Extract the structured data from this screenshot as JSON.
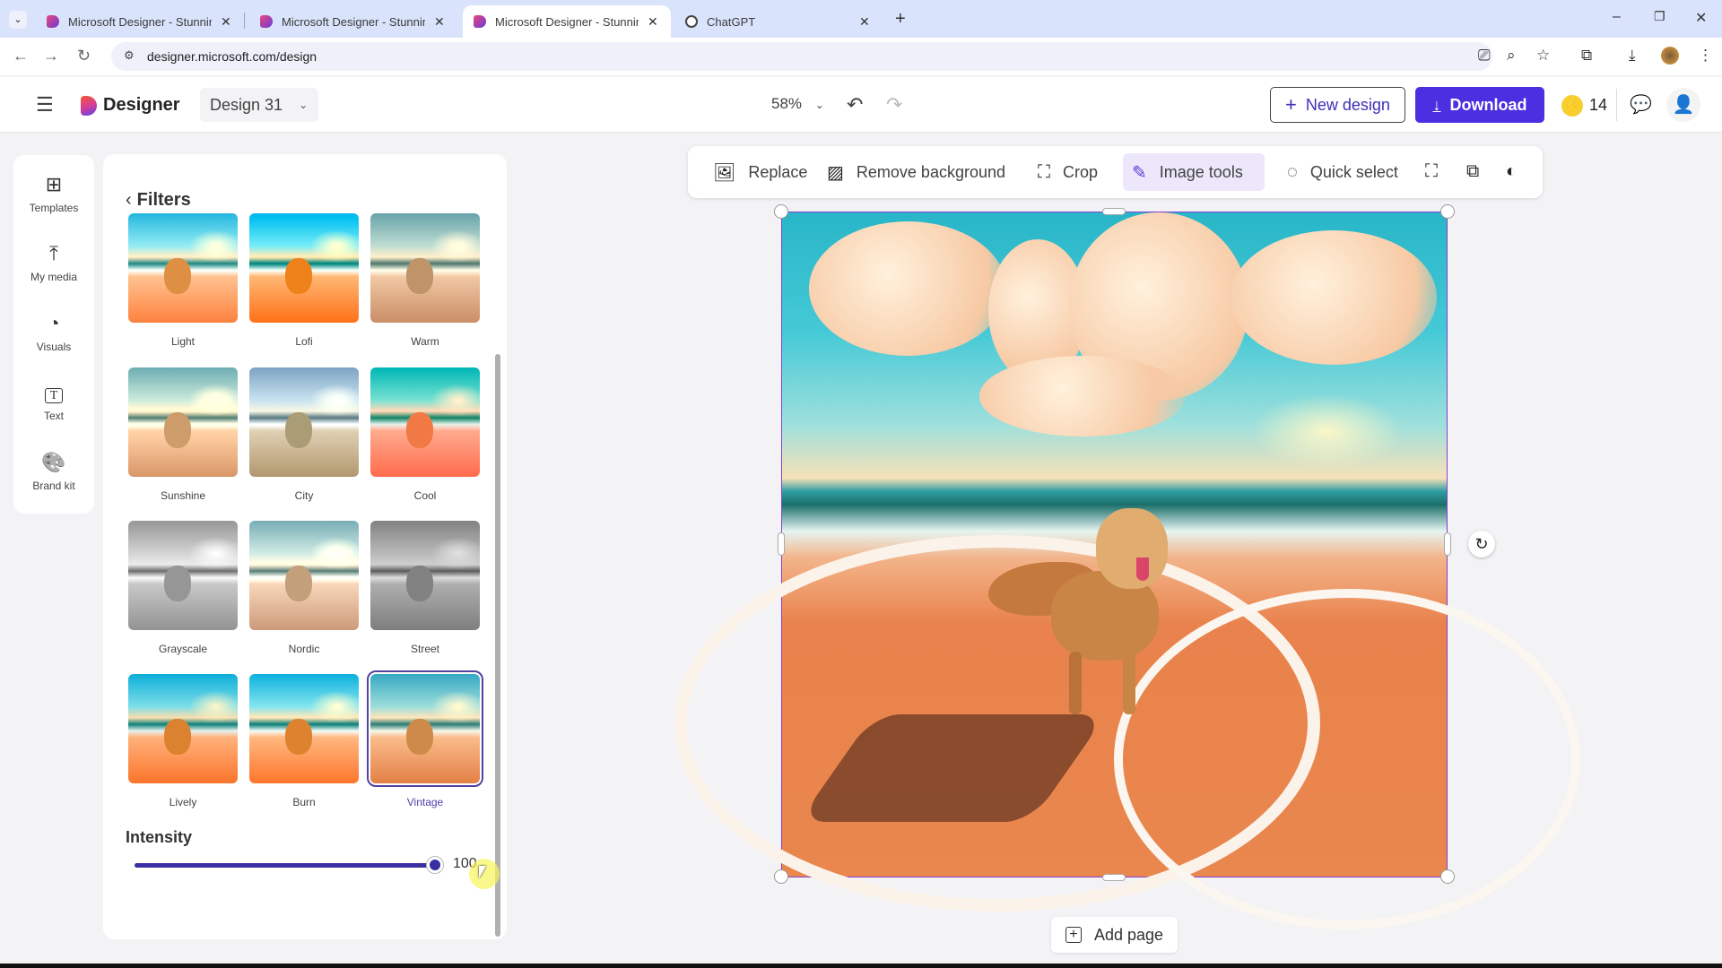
{
  "browser": {
    "tabs": [
      {
        "title": "Microsoft Designer - Stunning designs",
        "active": false,
        "icon": "designer-favicon"
      },
      {
        "title": "Microsoft Designer - Stunning designs",
        "active": false,
        "icon": "designer-favicon"
      },
      {
        "title": "Microsoft Designer - Stunning designs",
        "active": true,
        "icon": "designer-favicon"
      },
      {
        "title": "ChatGPT",
        "active": false,
        "icon": "chatgpt-favicon"
      }
    ],
    "new_tab": "+",
    "url": "designer.microsoft.com/design",
    "window_controls": {
      "minimize": "–",
      "restore": "❐",
      "close": "✕"
    }
  },
  "header": {
    "menu_icon": "☰",
    "app_name": "Designer",
    "design_name": "Design 31",
    "design_chevron": "⌄",
    "zoom": "58%",
    "zoom_chevron": "⌄",
    "undo": "↶",
    "redo": "↷",
    "new_design_label": "New design",
    "download_label": "Download",
    "credits": "14",
    "brand_color": "#4b2fe0"
  },
  "rail": {
    "items": [
      {
        "label": "Templates",
        "icon": "⊞"
      },
      {
        "label": "My media",
        "icon": "⤒"
      },
      {
        "label": "Visuals",
        "icon": "◔"
      },
      {
        "label": "Text",
        "icon": "T"
      },
      {
        "label": "Brand kit",
        "icon": "🎨"
      }
    ]
  },
  "filters": {
    "title": "Filters",
    "back": "‹",
    "items": [
      {
        "label": "Light",
        "selected": false
      },
      {
        "label": "Lofi",
        "selected": false
      },
      {
        "label": "Warm",
        "selected": false
      },
      {
        "label": "Sunshine",
        "selected": false
      },
      {
        "label": "City",
        "selected": false
      },
      {
        "label": "Cool",
        "selected": false
      },
      {
        "label": "Grayscale",
        "selected": false
      },
      {
        "label": "Nordic",
        "selected": false
      },
      {
        "label": "Street",
        "selected": false
      },
      {
        "label": "Lively",
        "selected": false
      },
      {
        "label": "Burn",
        "selected": false
      },
      {
        "label": "Vintage",
        "selected": true
      }
    ],
    "intensity_label": "Intensity",
    "intensity_value": "100",
    "intensity_fraction": 1.0
  },
  "toolbar": {
    "replace": "Replace",
    "remove_bg": "Remove background",
    "crop": "Crop",
    "image_tools": "Image tools",
    "quick_select": "Quick select"
  },
  "canvas": {
    "add_page": "Add page",
    "rotate": "↻"
  }
}
